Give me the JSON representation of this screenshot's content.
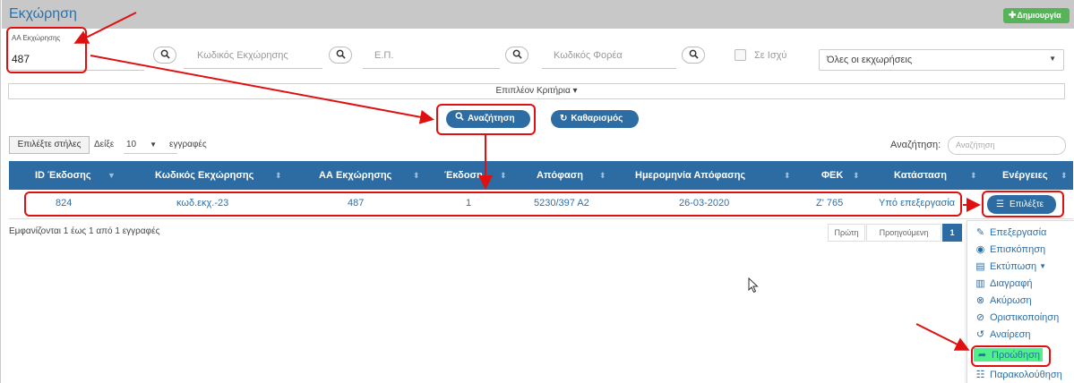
{
  "header": {
    "title": "Εκχώρηση",
    "create_label": "Δημιουργία"
  },
  "filters": {
    "aa_label": "ΑΑ Εκχώρησης",
    "aa_value": "487",
    "code_placeholder": "Κωδικός Εκχώρησης",
    "ep_placeholder": "Ε.Π.",
    "carrier_placeholder": "Κωδικός Φορέα",
    "in_force_label": "Σε Ισχύ",
    "status_select": "Όλες οι εκχωρήσεις"
  },
  "more_criteria": "Επιπλέον Κριτήρια",
  "buttons": {
    "search": "Αναζήτηση",
    "clear": "Καθαρισμός"
  },
  "table_controls": {
    "choose_columns": "Επιλέξτε στήλες",
    "show_label": "Δείξε",
    "page_size": "10",
    "records_label": "εγγραφές",
    "search_label": "Αναζήτηση:",
    "search_placeholder": "Αναζήτηση"
  },
  "table": {
    "columns": [
      "ID Έκδοσης",
      "Κωδικός Εκχώρησης",
      "ΑΑ Εκχώρησης",
      "Έκδοση",
      "Απόφαση",
      "Ημερομηνία Απόφασης",
      "ΦΕΚ",
      "Κατάσταση",
      "Ενέργειες"
    ],
    "rows": [
      {
        "id": "824",
        "code": "κωδ.εκχ.-23",
        "aa": "487",
        "version": "1",
        "decision": "5230/397 Α2",
        "date": "26-03-2020",
        "fek": "Ζ' 765",
        "status": "Υπό επεξεργασία",
        "action": "Επιλέξτε"
      }
    ]
  },
  "footer": {
    "info": "Εμφανίζονται 1 έως 1 από 1 εγγραφές",
    "first": "Πρώτη",
    "prev": "Προηγούμενη",
    "page": "1"
  },
  "menu": {
    "items": [
      {
        "label": "Επεξεργασία",
        "icon": "edit-icon"
      },
      {
        "label": "Επισκόπηση",
        "icon": "eye-icon"
      },
      {
        "label": "Εκτύπωση",
        "icon": "print-icon"
      },
      {
        "label": "Διαγραφή",
        "icon": "trash-icon"
      },
      {
        "label": "Ακύρωση",
        "icon": "cancel-circle-icon"
      },
      {
        "label": "Οριστικοποίηση",
        "icon": "check-circle-icon"
      },
      {
        "label": "Αναίρεση",
        "icon": "undo-icon"
      },
      {
        "label": "Προώθηση",
        "icon": "forward-icon"
      },
      {
        "label": "Παρακολούθηση",
        "icon": "list-icon"
      }
    ]
  },
  "colors": {
    "primary": "#2d6ca3",
    "create": "#57b25a",
    "annotation": "#e01010",
    "highlight": "#4ef08a"
  }
}
